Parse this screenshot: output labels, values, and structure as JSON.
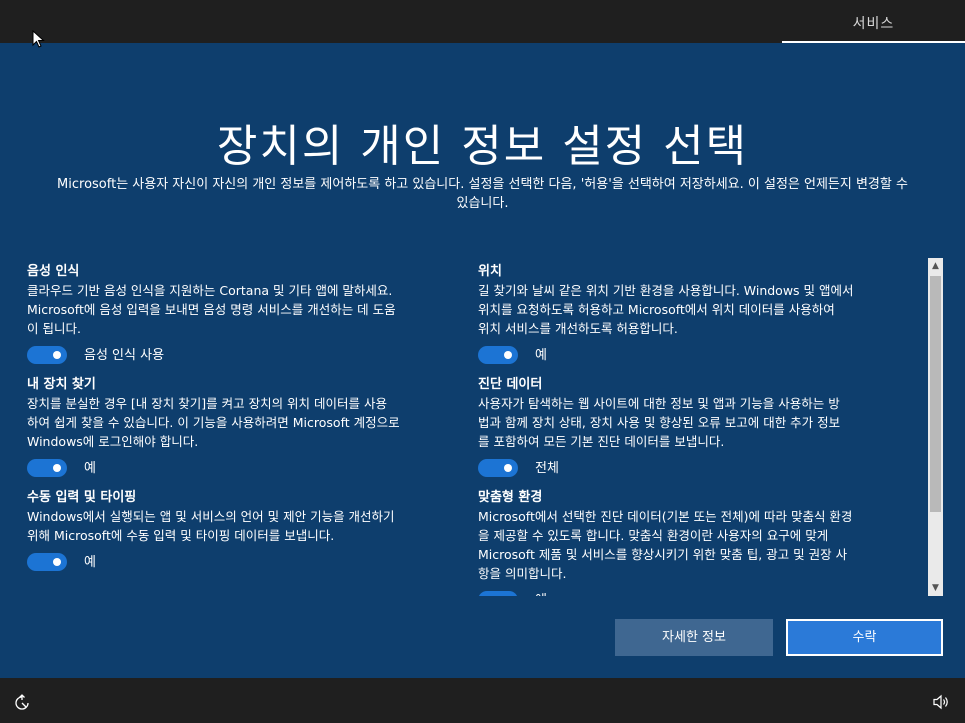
{
  "top_bar": {
    "tab_label": "서비스"
  },
  "header": {
    "title": "장치의 개인 정보 설정 선택",
    "subtitle": "Microsoft는 사용자 자신이 자신의 개인 정보를 제어하도록 하고 있습니다. 설정을 선택한 다음, '허용'을 선택하여 저장하세요. 이 설정은 언제든지 변경할 수 있습니다."
  },
  "settings_left": [
    {
      "title": "음성 인식",
      "desc_lines": [
        "클라우드 기반 음성 인식을 지원하는 Cortana 및 기타 앱에 말하세요.",
        "Microsoft에 음성 입력을 보내면 음성 명령 서비스를 개선하는 데 도움",
        "이 됩니다."
      ],
      "toggle_label": "음성 인식 사용",
      "on": true
    },
    {
      "title": "내 장치 찾기",
      "desc_lines": [
        "장치를 분실한 경우 [내 장치 찾기]를 켜고 장치의 위치 데이터를 사용",
        "하여 쉽게 찾을 수 있습니다. 이 기능을 사용하려면 Microsoft 계정으로",
        "Windows에 로그인해야 합니다."
      ],
      "toggle_label": "예",
      "on": true
    },
    {
      "title": "수동 입력 및 타이핑",
      "desc_lines": [
        "Windows에서 실행되는 앱 및 서비스의 언어 및 제안 기능을 개선하기",
        "위해 Microsoft에 수동 입력 및 타이핑 데이터를 보냅니다."
      ],
      "toggle_label": "예",
      "on": true
    }
  ],
  "settings_right": [
    {
      "title": "위치",
      "desc_lines": [
        "길 찾기와 날씨 같은 위치 기반 환경을 사용합니다. Windows 및 앱에서",
        "위치를 요청하도록 허용하고 Microsoft에서 위치 데이터를 사용하여",
        "위치 서비스를 개선하도록 허용합니다."
      ],
      "toggle_label": "예",
      "on": true
    },
    {
      "title": "진단 데이터",
      "desc_lines": [
        "사용자가 탐색하는 웹 사이트에 대한 정보 및 앱과 기능을 사용하는 방",
        "법과 함께 장치 상태, 장치 사용 및 향상된 오류 보고에 대한 추가 정보",
        "를 포함하여 모든 기본 진단 데이터를 보냅니다."
      ],
      "toggle_label": "전체",
      "on": true
    },
    {
      "title": "맞춤형 환경",
      "desc_lines": [
        "Microsoft에서 선택한 진단 데이터(기본 또는 전체)에 따라 맞춤식 환경",
        "을 제공할 수 있도록 합니다. 맞춤식 환경이란 사용자의 요구에 맞게",
        "Microsoft 제품 및 서비스를 향상시키기 위한 맞춤 팁, 광고 및 권장 사",
        "항을 의미합니다."
      ],
      "toggle_label": "예",
      "on": true
    }
  ],
  "buttons": {
    "learn_more": "자세한 정보",
    "accept": "수락"
  },
  "colors": {
    "background": "#0e3e6d",
    "toggle_on": "#1c74d4",
    "accept_button": "#2b7ad8",
    "learn_more_button": "#3f6791",
    "bar": "#1f1f1f"
  },
  "icons": {
    "cursor": "mouse-pointer-icon",
    "ease_of_access": "ease-of-access-icon",
    "volume": "volume-icon",
    "scroll_up": "chevron-up-icon",
    "scroll_down": "chevron-down-icon"
  }
}
